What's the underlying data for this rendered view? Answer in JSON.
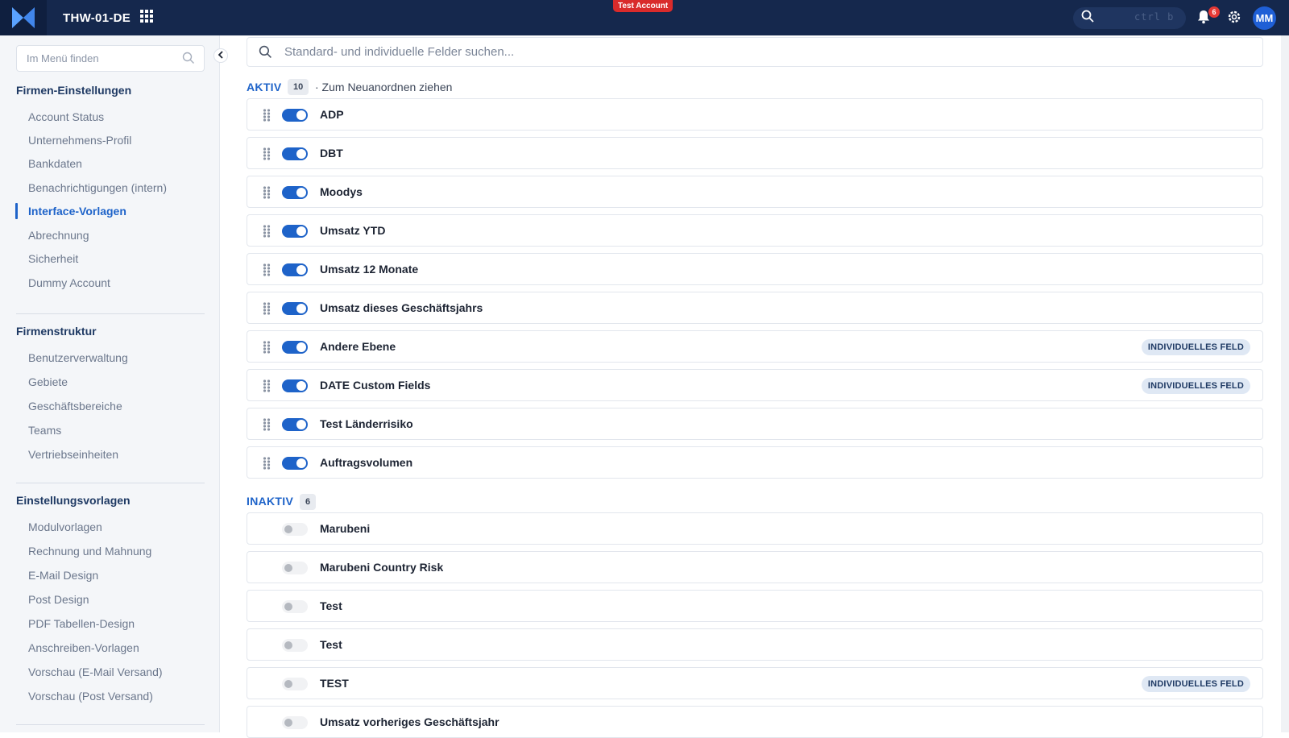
{
  "header": {
    "workspace": "THW-01-DE",
    "env_badge": "Test Account",
    "search_shortcut": "ctrl b",
    "notification_count": "6",
    "avatar_initials": "MM",
    "icons": [
      "logo-icon",
      "apps-grid-icon",
      "search-icon",
      "bell-icon",
      "gear-icon"
    ]
  },
  "sidebar": {
    "search_placeholder": "Im Menü finden",
    "sections": [
      {
        "title": "Firmen-Einstellungen",
        "items": [
          "Account Status",
          "Unternehmens-Profil",
          "Bankdaten",
          "Benachrichtigungen (intern)",
          "Interface-Vorlagen",
          "Abrechnung",
          "Sicherheit",
          "Dummy Account"
        ]
      },
      {
        "title": "Firmenstruktur",
        "items": [
          "Benutzerverwaltung",
          "Gebiete",
          "Geschäftsbereiche",
          "Teams",
          "Vertriebseinheiten"
        ]
      },
      {
        "title": "Einstellungsvorlagen",
        "items": [
          "Modulvorlagen",
          "Rechnung und Mahnung",
          "E-Mail Design",
          "Post Design",
          "PDF Tabellen-Design",
          "Anschreiben-Vorlagen",
          "Vorschau (E-Mail Versand)",
          "Vorschau (Post Versand)"
        ]
      }
    ],
    "active_item": "Interface-Vorlagen"
  },
  "main": {
    "search_placeholder": "Standard- und individuelle Felder suchen...",
    "active_group": {
      "label": "AKTIV",
      "count": "10",
      "hint": "· Zum Neuanordnen ziehen"
    },
    "inactive_group": {
      "label": "INAKTIV",
      "count": "6"
    },
    "custom_badge_label": "INDIVIDUELLES FELD",
    "active_fields": [
      {
        "label": "ADP",
        "custom": false
      },
      {
        "label": "DBT",
        "custom": false
      },
      {
        "label": "Moodys",
        "custom": false
      },
      {
        "label": "Umsatz YTD",
        "custom": false
      },
      {
        "label": "Umsatz 12 Monate",
        "custom": false
      },
      {
        "label": "Umsatz dieses Geschäftsjahrs",
        "custom": false
      },
      {
        "label": "Andere Ebene",
        "custom": true
      },
      {
        "label": "DATE Custom Fields",
        "custom": true
      },
      {
        "label": "Test Länderrisiko",
        "custom": false
      },
      {
        "label": "Auftragsvolumen",
        "custom": false
      }
    ],
    "inactive_fields": [
      {
        "label": "Marubeni",
        "custom": false
      },
      {
        "label": "Marubeni Country Risk",
        "custom": false
      },
      {
        "label": "Test",
        "custom": false
      },
      {
        "label": "Test",
        "custom": false
      },
      {
        "label": "TEST",
        "custom": true
      },
      {
        "label": "Umsatz vorheriges Geschäftsjahr",
        "custom": false
      }
    ]
  },
  "colors": {
    "topbar": "#15284d",
    "accent": "#1e63c9",
    "env_badge": "#d92b2b"
  }
}
